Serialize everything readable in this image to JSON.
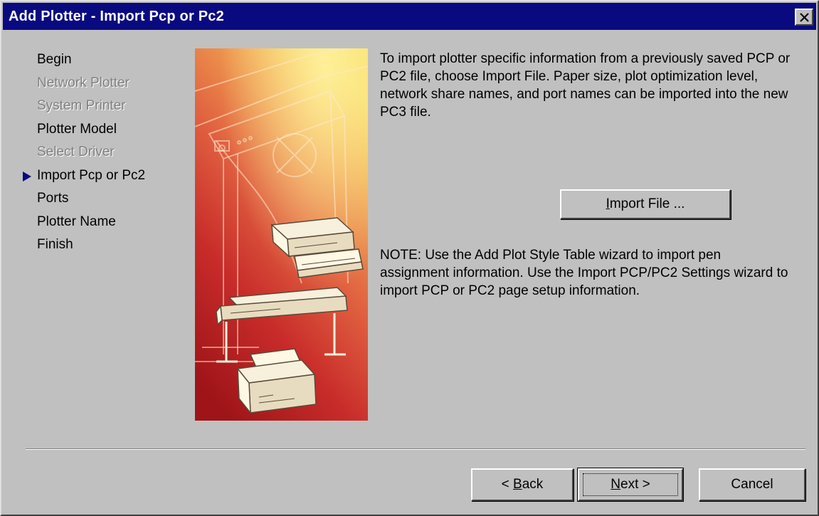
{
  "window": {
    "title": "Add Plotter - Import Pcp or Pc2"
  },
  "steps": [
    {
      "label": "Begin",
      "state": "enabled"
    },
    {
      "label": "Network Plotter",
      "state": "disabled"
    },
    {
      "label": "System Printer",
      "state": "disabled"
    },
    {
      "label": "Plotter Model",
      "state": "enabled"
    },
    {
      "label": "Select Driver",
      "state": "disabled"
    },
    {
      "label": "Import Pcp or Pc2",
      "state": "current"
    },
    {
      "label": "Ports",
      "state": "enabled"
    },
    {
      "label": "Plotter Name",
      "state": "enabled"
    },
    {
      "label": "Finish",
      "state": "enabled"
    }
  ],
  "content": {
    "description": "To import plotter specific information from a previously saved PCP or PC2 file, choose Import File. Paper size, plot optimization level, network share names, and port names can be imported into the new PC3 file.",
    "note": "NOTE: Use the Add Plot Style Table wizard to import pen assignment information. Use the Import PCP/PC2 Settings wizard to import PCP or PC2 page setup information."
  },
  "buttons": {
    "import_mnemonic": "I",
    "import_rest": "mport File ...",
    "back_prefix": "< ",
    "back_mnemonic": "B",
    "back_rest": "ack",
    "next_mnemonic": "N",
    "next_rest": "ext >",
    "cancel": "Cancel"
  },
  "icons": {
    "close": "close-icon",
    "current_step": "arrow-right-icon",
    "illustration": "plotter-illustration"
  },
  "colors": {
    "titlebar": "#0a0a80",
    "dialog": "#c0c0c0",
    "disabled_text": "#808080",
    "illustration_top": "#f3c84a",
    "illustration_bottom": "#b0181c"
  }
}
